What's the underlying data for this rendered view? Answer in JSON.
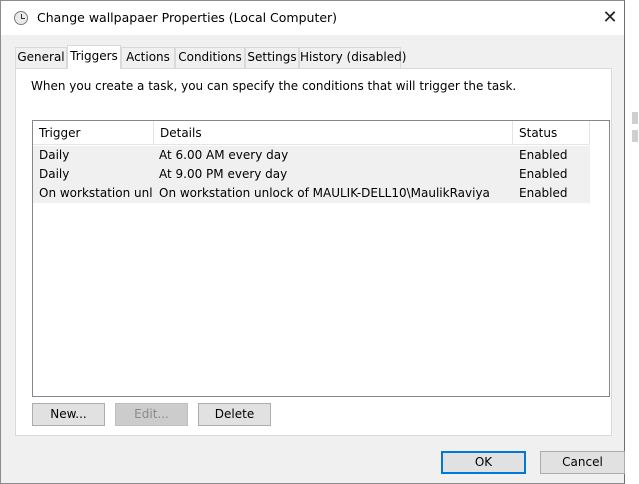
{
  "window": {
    "title": "Change wallpapaer Properties (Local Computer)",
    "close_glyph": "✕"
  },
  "tabs": [
    {
      "label": "General",
      "active": false
    },
    {
      "label": "Triggers",
      "active": true
    },
    {
      "label": "Actions",
      "active": false
    },
    {
      "label": "Conditions",
      "active": false
    },
    {
      "label": "Settings",
      "active": false
    },
    {
      "label": "History (disabled)",
      "active": false
    }
  ],
  "triggers_panel": {
    "intro": "When you create a task, you can specify the conditions that will trigger the task.",
    "columns": [
      "Trigger",
      "Details",
      "Status"
    ],
    "rows": [
      {
        "trigger": "Daily",
        "details": "At 6.00 AM every day",
        "status": "Enabled"
      },
      {
        "trigger": "Daily",
        "details": "At 9.00 PM every day",
        "status": "Enabled"
      },
      {
        "trigger": "On workstation unl",
        "details": "On workstation unlock of MAULIK-DELL10\\MaulikRaviya",
        "status": "Enabled"
      }
    ],
    "buttons": {
      "new": "New...",
      "edit": "Edit...",
      "delete": "Delete"
    }
  },
  "footer": {
    "ok": "OK",
    "cancel": "Cancel"
  },
  "colors": {
    "dialog_bg": "#f0f0f0",
    "row_bg": "#f0f0f0",
    "accent": "#0078d7"
  }
}
